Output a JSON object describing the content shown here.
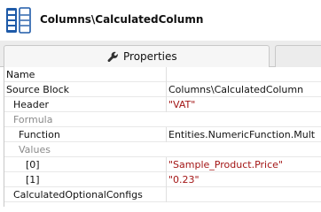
{
  "header": {
    "title": "Columns\\CalculatedColumn",
    "icon": "table-columns-icon"
  },
  "tabs": {
    "properties_label": "Properties",
    "properties_icon": "wrench-icon"
  },
  "rows": [
    {
      "name": "Name",
      "value": ""
    },
    {
      "name": "Source Block",
      "value": "Columns\\CalculatedColumn"
    },
    {
      "name": "Header",
      "value": "\"VAT\""
    },
    {
      "name": "Formula",
      "value": ""
    },
    {
      "name": "Function",
      "value": "Entities.NumericFunction.Mult"
    },
    {
      "name": "Values",
      "value": ""
    },
    {
      "name": "[0]",
      "value": "\"Sample_Product.Price\""
    },
    {
      "name": "[1]",
      "value": "\"0.23\""
    },
    {
      "name": "CalculatedOptionalConfigs",
      "value": ""
    }
  ],
  "colors": {
    "string_value": "#a31515",
    "group_label": "#8a8a8a",
    "icon_blue": "#1e5aa8"
  }
}
